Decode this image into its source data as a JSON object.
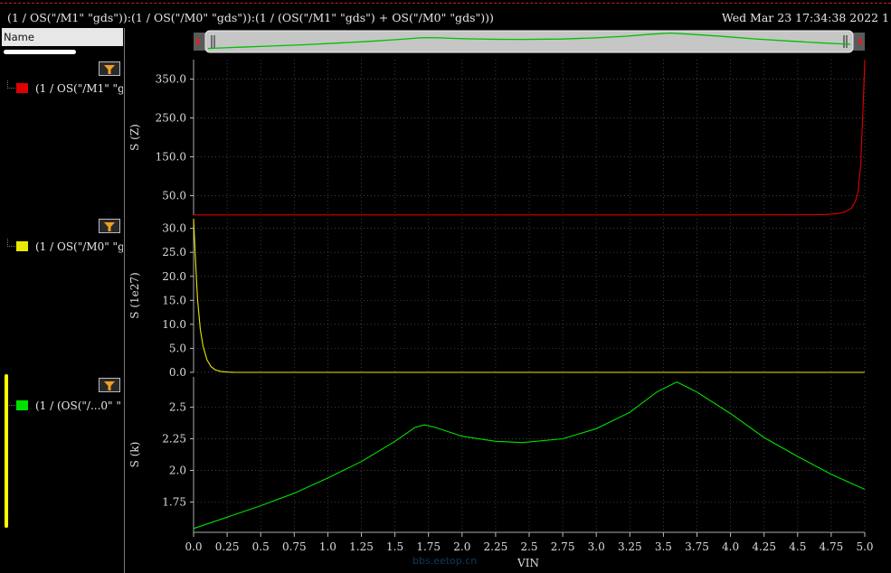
{
  "window": {
    "title": "(1 / OS(\"/M1\" \"gds\")):(1 / OS(\"/M0\" \"gds\")):(1 / (OS(\"/M1\" \"gds\") + OS(\"/M0\" \"gds\")))",
    "datetime": "Wed Mar 23 17:34:38 2022  1",
    "watermark": "bbs.eetop.cn"
  },
  "legend_pane": {
    "header": "Name",
    "traces": [
      {
        "label": "(1 / OS(\"/M1\" \"gds\"",
        "color": "#e00000"
      },
      {
        "label": "(1 / OS(\"/M0\" \"gds\"",
        "color": "#e8e800"
      },
      {
        "label": "(1 / (OS(\"/...0\" \"",
        "color": "#00e000"
      }
    ],
    "icons": [
      "filter-funnel-icon",
      "filter-funnel-icon",
      "filter-funnel-icon"
    ]
  },
  "chart_data": [
    {
      "type": "line",
      "ylabel": "S (Z)",
      "xlabel": "",
      "xlim": [
        0,
        5
      ],
      "ylim": [
        0,
        400
      ],
      "yticks": [
        50.0,
        150.0,
        250.0,
        350.0
      ],
      "ytick_labels": [
        "50.0",
        "150.0",
        "250.0",
        "350.0"
      ],
      "color": "#e00000",
      "x": [
        0,
        0.5,
        1.0,
        1.5,
        2.0,
        2.5,
        3.0,
        3.5,
        4.0,
        4.5,
        4.7,
        4.8,
        4.85,
        4.9,
        4.93,
        4.95,
        4.97,
        4.99,
        5.0
      ],
      "y": [
        0.5,
        0.5,
        0.5,
        0.5,
        0.5,
        0.5,
        0.5,
        0.5,
        0.5,
        0.6,
        1.5,
        4,
        8,
        18,
        35,
        60,
        130,
        300,
        420
      ],
      "grid": true
    },
    {
      "type": "line",
      "ylabel": "S (1e27)",
      "xlabel": "",
      "xlim": [
        0,
        5
      ],
      "ylim": [
        0,
        32
      ],
      "yticks": [
        0.0,
        5.0,
        10.0,
        15.0,
        20.0,
        25.0,
        30.0
      ],
      "ytick_labels": [
        "0.0",
        "5.0",
        "10.0",
        "15.0",
        "20.0",
        "25.0",
        "30.0"
      ],
      "color": "#e8e800",
      "x": [
        0,
        0.01,
        0.02,
        0.03,
        0.05,
        0.07,
        0.1,
        0.13,
        0.16,
        0.2,
        0.25,
        0.3,
        0.5,
        1.0,
        2.0,
        3.0,
        4.0,
        5.0
      ],
      "y": [
        32,
        26,
        20,
        15,
        9,
        5.5,
        2.6,
        1.2,
        0.55,
        0.2,
        0.05,
        0.01,
        0,
        0,
        0,
        0,
        0,
        0
      ],
      "grid": true
    },
    {
      "type": "line",
      "ylabel": "S (k)",
      "xlabel": "VIN",
      "xlim": [
        0,
        5
      ],
      "ylim": [
        1.51,
        2.74
      ],
      "yticks": [
        1.75,
        2.0,
        2.25,
        2.5
      ],
      "ytick_labels": [
        "1.75",
        "2.0",
        "2.25",
        "2.5"
      ],
      "xticks": [
        0,
        0.25,
        0.5,
        0.75,
        1.0,
        1.25,
        1.5,
        1.75,
        2.0,
        2.25,
        2.5,
        2.75,
        3.0,
        3.25,
        3.5,
        3.75,
        4.0,
        4.25,
        4.5,
        4.75,
        5.0
      ],
      "xtick_labels": [
        "0.0",
        "0.25",
        "0.5",
        "0.75",
        "1.0",
        "1.25",
        "1.5",
        "1.75",
        "2.0",
        "2.25",
        "2.5",
        "2.75",
        "3.0",
        "3.25",
        "3.5",
        "3.75",
        "4.0",
        "4.25",
        "4.5",
        "4.75",
        "5.0"
      ],
      "color": "#00e000",
      "x": [
        0,
        0.25,
        0.5,
        0.75,
        1.0,
        1.25,
        1.5,
        1.65,
        1.72,
        1.8,
        2.0,
        2.25,
        2.45,
        2.75,
        3.0,
        3.25,
        3.45,
        3.6,
        3.75,
        4.0,
        4.25,
        4.5,
        4.75,
        5.0
      ],
      "y": [
        1.54,
        1.63,
        1.72,
        1.82,
        1.94,
        2.07,
        2.23,
        2.34,
        2.36,
        2.34,
        2.27,
        2.23,
        2.22,
        2.25,
        2.33,
        2.46,
        2.62,
        2.7,
        2.62,
        2.45,
        2.26,
        2.11,
        1.97,
        1.85
      ],
      "grid": true
    }
  ]
}
